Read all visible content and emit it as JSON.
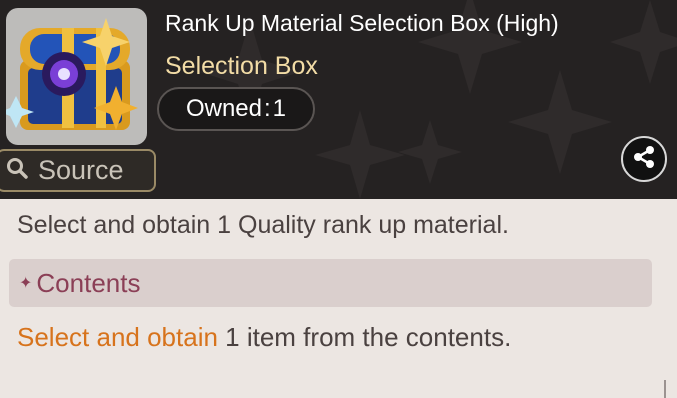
{
  "item": {
    "title": "Rank Up Material Selection Box (High)",
    "type": "Selection Box",
    "owned_label": "Owned",
    "owned_separator": ":",
    "owned_count": "1",
    "image_icon": "treasure-chest-icon"
  },
  "buttons": {
    "source_label": "Source",
    "source_icon": "search-icon",
    "share_icon": "share-icon"
  },
  "description": "Select and obtain 1 Quality rank up material.",
  "contents": {
    "header_symbol": "✦",
    "header_label": "Contents",
    "text_highlight": "Select and obtain",
    "text_rest": " 1 item from the contents."
  },
  "colors": {
    "header_bg": "#252222",
    "panel_bg": "#ece6e2",
    "title": "#ffffff",
    "subtitle": "#f2dca6",
    "contents_accent": "#8b3f56",
    "highlight": "#d7731c",
    "body_text": "#4a4140"
  }
}
